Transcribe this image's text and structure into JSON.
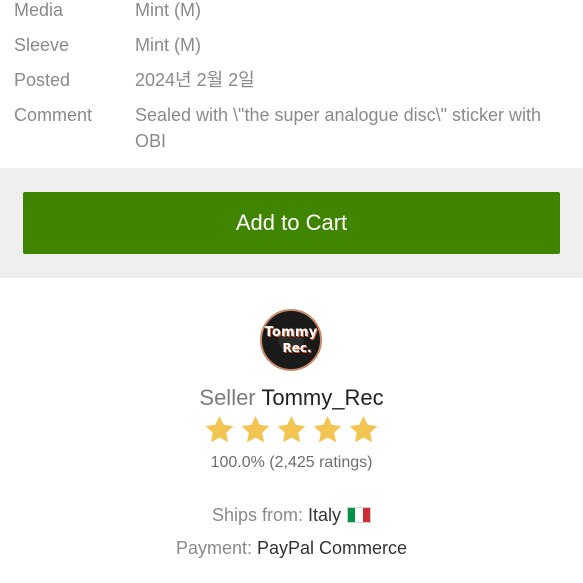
{
  "details": {
    "media": {
      "label": "Media",
      "value": "Mint (M)"
    },
    "sleeve": {
      "label": "Sleeve",
      "value": "Mint (M)"
    },
    "posted": {
      "label": "Posted",
      "value": "2024년 2월 2일"
    },
    "comment": {
      "label": "Comment",
      "value": "Sealed with \\\"the super analogue disc\\\" sticker with OBI"
    }
  },
  "cart": {
    "button_label": "Add to Cart",
    "color": "#3f8500"
  },
  "seller": {
    "avatar_line1": "Tommy",
    "avatar_line2": "Rec.",
    "prefix": "Seller",
    "name": "Tommy_Rec",
    "rating_stars": 5,
    "ratings_text": "100.0% (2,425 ratings)",
    "ships_label": "Ships from:",
    "ships_country": "Italy",
    "flag_icon": "italy-flag-icon",
    "payment_label": "Payment:",
    "payment_method": "PayPal Commerce"
  },
  "colors": {
    "star": "#f2c552",
    "flag_green": "#009246",
    "flag_white": "#ffffff",
    "flag_red": "#ce2b37"
  }
}
